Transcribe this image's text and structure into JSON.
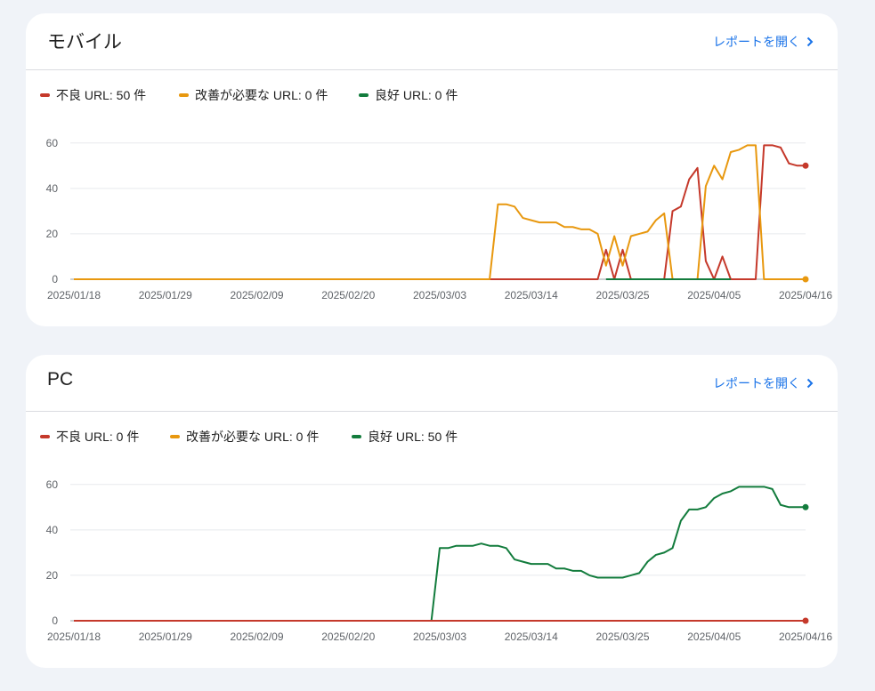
{
  "colors": {
    "bad": "#c5392b",
    "needs_improvement": "#e8980f",
    "good": "#137c3d",
    "link": "#1a73e8"
  },
  "mobile": {
    "title": "モバイル",
    "open_report_label": "レポートを開く",
    "open_report_icon": "chevron-right-icon",
    "legend": [
      "不良 URL: 50 件",
      "改善が必要な URL: 0 件",
      "良好 URL: 0 件"
    ]
  },
  "pc": {
    "title": "PC",
    "open_report_label": "レポートを開く",
    "open_report_icon": "chevron-right-icon",
    "legend": [
      "不良 URL: 0 件",
      "改善が必要な URL: 0 件",
      "良好 URL: 50 件"
    ]
  },
  "chart_data": [
    {
      "type": "line",
      "title": "モバイル",
      "xlabel": "",
      "ylabel": "",
      "x_ticks": [
        "2025/01/18",
        "2025/01/29",
        "2025/02/09",
        "2025/02/20",
        "2025/03/03",
        "2025/03/14",
        "2025/03/25",
        "2025/04/05",
        "2025/04/16"
      ],
      "y_ticks": [
        0,
        20,
        40,
        60
      ],
      "ylim": [
        0,
        65
      ],
      "xlim": [
        "2025/01/18",
        "2025/04/16"
      ],
      "grid": true,
      "legend_position": "top-left",
      "series": [
        {
          "name": "不良 URL: 50 件",
          "color": "#c5392b",
          "end_marker": true,
          "points": [
            [
              "2025/01/18",
              0
            ],
            [
              "2025/03/22",
              0
            ],
            [
              "2025/03/23",
              13
            ],
            [
              "2025/03/24",
              0
            ],
            [
              "2025/03/25",
              13
            ],
            [
              "2025/03/26",
              0
            ],
            [
              "2025/03/30",
              0
            ],
            [
              "2025/03/31",
              30
            ],
            [
              "2025/04/01",
              32
            ],
            [
              "2025/04/02",
              44
            ],
            [
              "2025/04/03",
              49
            ],
            [
              "2025/04/04",
              8
            ],
            [
              "2025/04/05",
              0
            ],
            [
              "2025/04/06",
              10
            ],
            [
              "2025/04/07",
              0
            ],
            [
              "2025/04/10",
              0
            ],
            [
              "2025/04/11",
              59
            ],
            [
              "2025/04/12",
              59
            ],
            [
              "2025/04/13",
              58
            ],
            [
              "2025/04/14",
              51
            ],
            [
              "2025/04/15",
              50
            ],
            [
              "2025/04/16",
              50
            ]
          ]
        },
        {
          "name": "改善が必要な URL: 0 件",
          "color": "#e8980f",
          "end_marker": true,
          "points": [
            [
              "2025/01/18",
              0
            ],
            [
              "2025/03/09",
              0
            ],
            [
              "2025/03/10",
              33
            ],
            [
              "2025/03/11",
              33
            ],
            [
              "2025/03/12",
              32
            ],
            [
              "2025/03/13",
              27
            ],
            [
              "2025/03/14",
              26
            ],
            [
              "2025/03/15",
              25
            ],
            [
              "2025/03/16",
              25
            ],
            [
              "2025/03/17",
              25
            ],
            [
              "2025/03/18",
              23
            ],
            [
              "2025/03/19",
              23
            ],
            [
              "2025/03/20",
              22
            ],
            [
              "2025/03/21",
              22
            ],
            [
              "2025/03/22",
              20
            ],
            [
              "2025/03/23",
              6
            ],
            [
              "2025/03/24",
              19
            ],
            [
              "2025/03/25",
              6
            ],
            [
              "2025/03/26",
              19
            ],
            [
              "2025/03/27",
              20
            ],
            [
              "2025/03/28",
              21
            ],
            [
              "2025/03/29",
              26
            ],
            [
              "2025/03/30",
              29
            ],
            [
              "2025/03/31",
              0
            ],
            [
              "2025/04/03",
              0
            ],
            [
              "2025/04/04",
              41
            ],
            [
              "2025/04/05",
              50
            ],
            [
              "2025/04/06",
              44
            ],
            [
              "2025/04/07",
              56
            ],
            [
              "2025/04/08",
              57
            ],
            [
              "2025/04/09",
              59
            ],
            [
              "2025/04/10",
              59
            ],
            [
              "2025/04/11",
              0
            ],
            [
              "2025/04/16",
              0
            ]
          ]
        },
        {
          "name": "良好 URL: 0 件",
          "color": "#137c3d",
          "end_marker": false,
          "points": [
            [
              "2025/03/23",
              0
            ],
            [
              "2025/03/24",
              0
            ],
            [
              "2025/03/25",
              0
            ],
            [
              "2025/03/31",
              0
            ],
            [
              "2025/04/03",
              0
            ],
            [
              "2025/04/05",
              0
            ],
            [
              "2025/04/07",
              0
            ]
          ]
        }
      ]
    },
    {
      "type": "line",
      "title": "PC",
      "xlabel": "",
      "ylabel": "",
      "x_ticks": [
        "2025/01/18",
        "2025/01/29",
        "2025/02/09",
        "2025/02/20",
        "2025/03/03",
        "2025/03/14",
        "2025/03/25",
        "2025/04/05",
        "2025/04/16"
      ],
      "y_ticks": [
        0,
        20,
        40,
        60
      ],
      "ylim": [
        0,
        65
      ],
      "xlim": [
        "2025/01/18",
        "2025/04/16"
      ],
      "grid": true,
      "legend_position": "top-left",
      "series": [
        {
          "name": "良好 URL: 50 件",
          "color": "#137c3d",
          "end_marker": true,
          "points": [
            [
              "2025/01/18",
              0
            ],
            [
              "2025/03/02",
              0
            ],
            [
              "2025/03/03",
              32
            ],
            [
              "2025/03/04",
              32
            ],
            [
              "2025/03/05",
              33
            ],
            [
              "2025/03/06",
              33
            ],
            [
              "2025/03/07",
              33
            ],
            [
              "2025/03/08",
              34
            ],
            [
              "2025/03/09",
              33
            ],
            [
              "2025/03/10",
              33
            ],
            [
              "2025/03/11",
              32
            ],
            [
              "2025/03/12",
              27
            ],
            [
              "2025/03/13",
              26
            ],
            [
              "2025/03/14",
              25
            ],
            [
              "2025/03/15",
              25
            ],
            [
              "2025/03/16",
              25
            ],
            [
              "2025/03/17",
              23
            ],
            [
              "2025/03/18",
              23
            ],
            [
              "2025/03/19",
              22
            ],
            [
              "2025/03/20",
              22
            ],
            [
              "2025/03/21",
              20
            ],
            [
              "2025/03/22",
              19
            ],
            [
              "2025/03/23",
              19
            ],
            [
              "2025/03/24",
              19
            ],
            [
              "2025/03/25",
              19
            ],
            [
              "2025/03/26",
              20
            ],
            [
              "2025/03/27",
              21
            ],
            [
              "2025/03/28",
              26
            ],
            [
              "2025/03/29",
              29
            ],
            [
              "2025/03/30",
              30
            ],
            [
              "2025/03/31",
              32
            ],
            [
              "2025/04/01",
              44
            ],
            [
              "2025/04/02",
              49
            ],
            [
              "2025/04/03",
              49
            ],
            [
              "2025/04/04",
              50
            ],
            [
              "2025/04/05",
              54
            ],
            [
              "2025/04/06",
              56
            ],
            [
              "2025/04/07",
              57
            ],
            [
              "2025/04/08",
              59
            ],
            [
              "2025/04/09",
              59
            ],
            [
              "2025/04/10",
              59
            ],
            [
              "2025/04/11",
              59
            ],
            [
              "2025/04/12",
              58
            ],
            [
              "2025/04/13",
              51
            ],
            [
              "2025/04/14",
              50
            ],
            [
              "2025/04/15",
              50
            ],
            [
              "2025/04/16",
              50
            ]
          ]
        },
        {
          "name": "改善が必要な URL: 0 件",
          "color": "#e8980f",
          "end_marker": false,
          "points": [
            [
              "2025/01/18",
              0
            ],
            [
              "2025/04/16",
              0
            ]
          ]
        },
        {
          "name": "不良 URL: 0 件",
          "color": "#c5392b",
          "end_marker": true,
          "points": [
            [
              "2025/01/18",
              0
            ],
            [
              "2025/04/16",
              0
            ]
          ]
        }
      ]
    }
  ]
}
